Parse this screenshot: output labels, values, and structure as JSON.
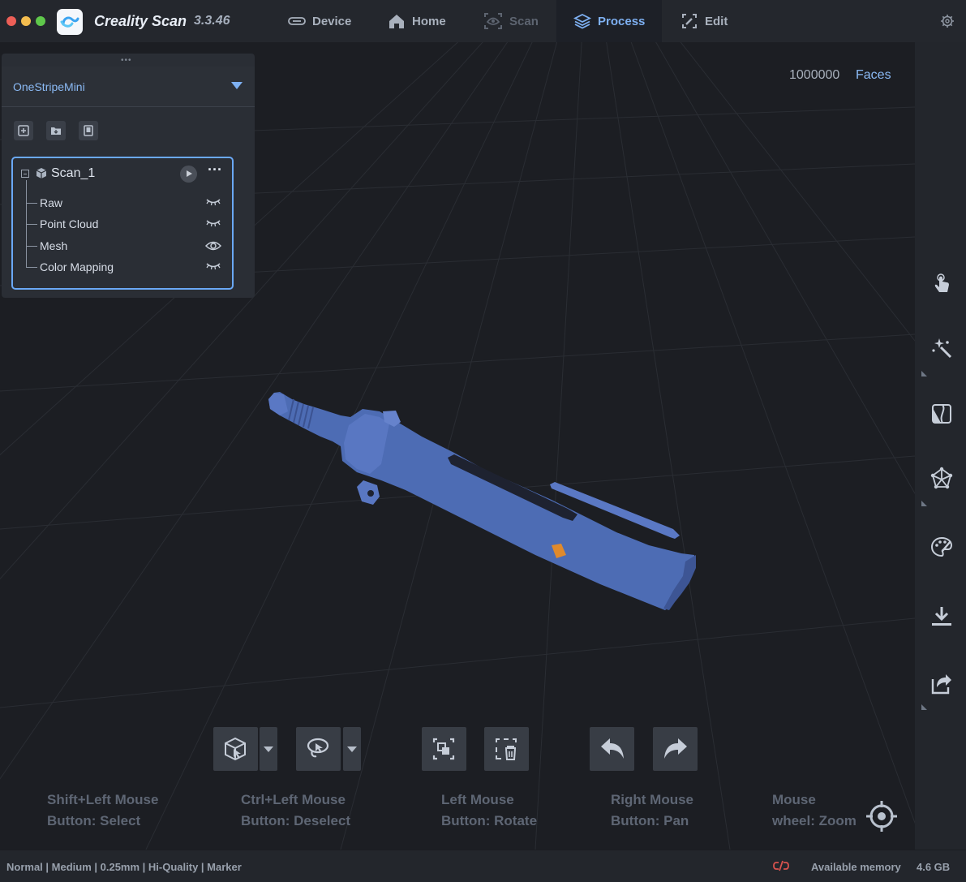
{
  "app": {
    "name": "Creality Scan",
    "version": "3.3.46"
  },
  "tabs": [
    {
      "label": "Device",
      "icon": "device-icon",
      "state": "normal"
    },
    {
      "label": "Home",
      "icon": "home-icon",
      "state": "normal"
    },
    {
      "label": "Scan",
      "icon": "scan-icon",
      "state": "disabled"
    },
    {
      "label": "Process",
      "icon": "layers-icon",
      "state": "active"
    },
    {
      "label": "Edit",
      "icon": "edit-icon",
      "state": "normal"
    }
  ],
  "viewport": {
    "faces_count": "1000000",
    "faces_label": "Faces"
  },
  "project": {
    "name": "OneStripeMini",
    "scan": {
      "name": "Scan_1",
      "items": [
        {
          "label": "Raw",
          "visibility": "hidden"
        },
        {
          "label": "Point Cloud",
          "visibility": "hidden"
        },
        {
          "label": "Mesh",
          "visibility": "visible"
        },
        {
          "label": "Color Mapping",
          "visibility": "hidden"
        }
      ]
    }
  },
  "right_toolbar": [
    "touch-icon",
    "magic-wand-icon",
    "mirror-icon",
    "mesh-network-icon",
    "palette-icon",
    "download-icon",
    "share-icon"
  ],
  "hints": [
    {
      "line1": "Shift+Left Mouse",
      "line2": "Button:  Select"
    },
    {
      "line1": "Ctrl+Left Mouse",
      "line2": "Button:  Deselect"
    },
    {
      "line1": "Left Mouse",
      "line2": "Button:  Rotate"
    },
    {
      "line1": "Right Mouse",
      "line2": "Button:  Pan"
    },
    {
      "line1": "Mouse",
      "line2": "wheel:  Zoom"
    }
  ],
  "status": {
    "settings": "Normal | Medium | 0.25mm | Hi-Quality | Marker",
    "memory_label": "Available memory",
    "memory_value": "4.6 GB"
  },
  "colors": {
    "accent": "#7eb0f2",
    "model": "#4f6fb8",
    "background": "#1c1e23"
  }
}
